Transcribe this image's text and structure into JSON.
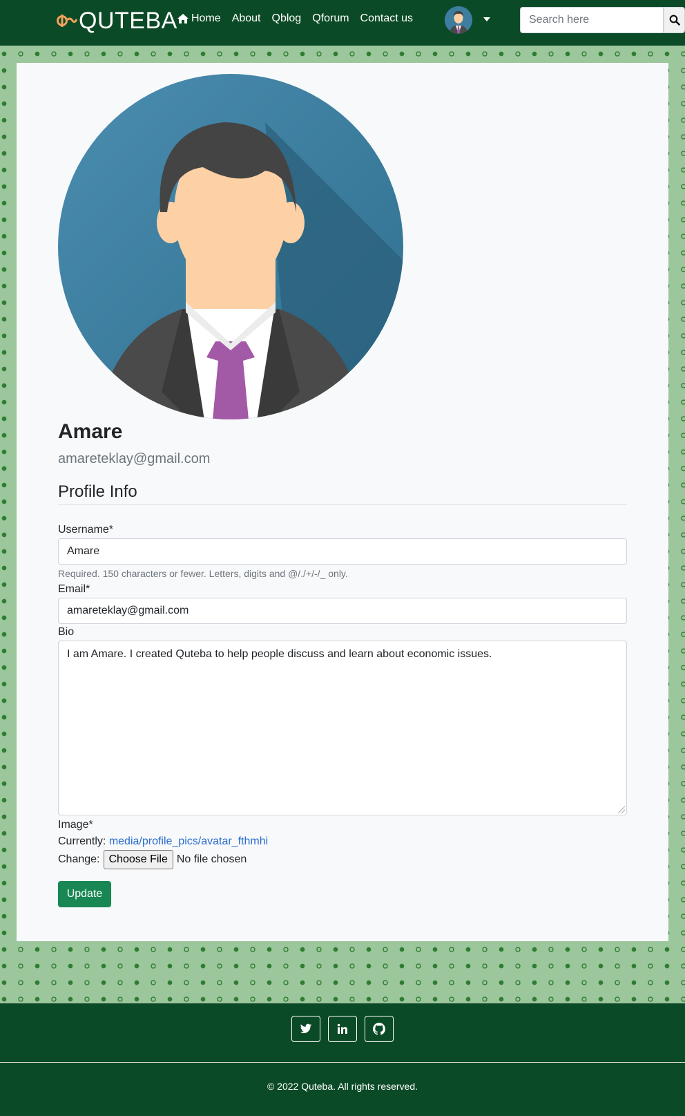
{
  "navbar": {
    "brand": "QUTEBA",
    "links": [
      {
        "label": "Home",
        "icon": "home-icon"
      },
      {
        "label": "About"
      },
      {
        "label": "Qblog"
      },
      {
        "label": "Qforum"
      },
      {
        "label": "Contact us"
      }
    ],
    "search_placeholder": "Search here"
  },
  "profile": {
    "username": "Amare",
    "email": "amareteklay@gmail.com"
  },
  "form": {
    "section_title": "Profile Info",
    "username_label": "Username*",
    "username_value": "Amare",
    "username_help": "Required. 150 characters or fewer. Letters, digits and @/./+/-/_ only.",
    "email_label": "Email*",
    "email_value": "amareteklay@gmail.com",
    "bio_label": "Bio",
    "bio_value": "I am Amare. I created Quteba to help people discuss and learn about economic issues.",
    "image_label": "Image*",
    "currently_label": "Currently:",
    "currently_link": "media/profile_pics/avatar_fthmhi",
    "change_label": "Change:",
    "choose_file": "Choose File",
    "no_file": "No file chosen",
    "submit": "Update"
  },
  "footer": {
    "social": [
      "twitter-icon",
      "linkedin-icon",
      "github-icon"
    ],
    "copyright": "2022 Quteba. All rights reserved."
  },
  "colors": {
    "primary_dark_green": "#0b4a26",
    "pattern_green": "#9cc69b",
    "button_green": "#198754",
    "brand_accent": "#f2a25b",
    "link_blue": "#2a6ccf"
  }
}
